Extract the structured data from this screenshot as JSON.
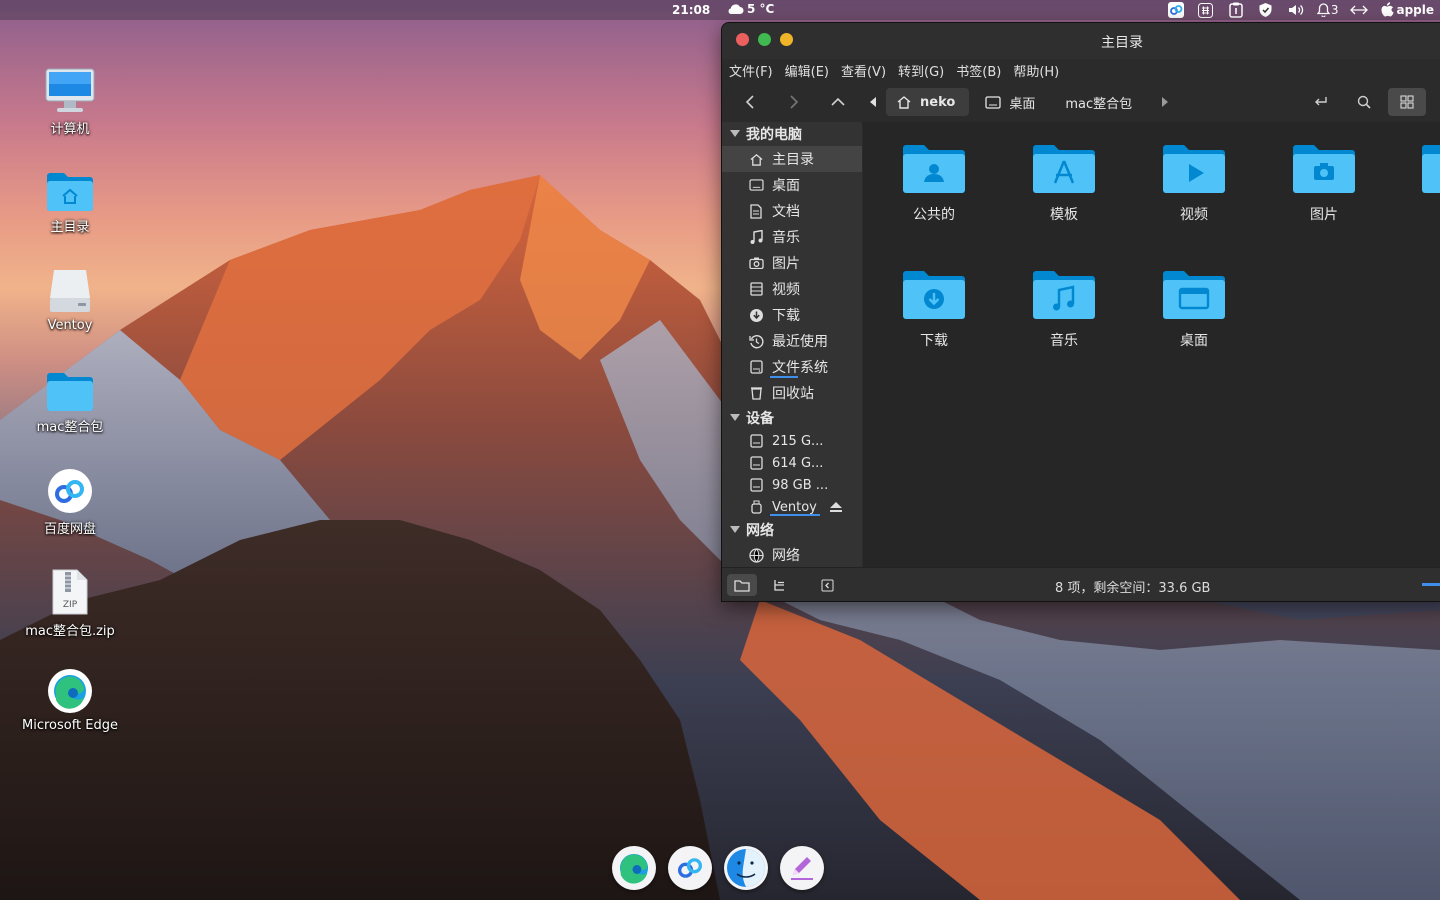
{
  "topbar": {
    "clock": "21:08",
    "weather": "5 °C",
    "notifications": "3",
    "user": "apple"
  },
  "desktop": {
    "icons": [
      {
        "label": "计算机",
        "icon": "computer-icon"
      },
      {
        "label": "主目录",
        "icon": "home-folder-icon"
      },
      {
        "label": "Ventoy",
        "icon": "drive-icon"
      },
      {
        "label": "mac整合包",
        "icon": "folder-icon"
      },
      {
        "label": "百度网盘",
        "icon": "baidu-netdisk-icon"
      },
      {
        "label": "mac整合包.zip",
        "icon": "zip-file-icon",
        "badge": "ZIP"
      },
      {
        "label": "Microsoft Edge",
        "icon": "edge-icon"
      }
    ]
  },
  "dock": [
    "edge-icon",
    "baidu-netdisk-icon",
    "finder-icon",
    "text-editor-icon"
  ],
  "window": {
    "title": "主目录",
    "menu": [
      "文件(F)",
      "编辑(E)",
      "查看(V)",
      "转到(G)",
      "书签(B)",
      "帮助(H)"
    ],
    "breadcrumbs": [
      "neko",
      "桌面",
      "mac整合包"
    ],
    "sidebar": {
      "sections": [
        {
          "title": "我的电脑",
          "items": [
            "主目录",
            "桌面",
            "文档",
            "音乐",
            "图片",
            "视频",
            "下载",
            "最近使用",
            "文件系统",
            "回收站"
          ]
        },
        {
          "title": "设备",
          "items": [
            "215 G...",
            "614 G...",
            "98 GB ...",
            "Ventoy"
          ]
        },
        {
          "title": "网络",
          "items": [
            "网络"
          ]
        }
      ]
    },
    "folders": [
      {
        "label": "公共的",
        "icon": "public-folder-icon"
      },
      {
        "label": "模板",
        "icon": "templates-folder-icon"
      },
      {
        "label": "视频",
        "icon": "videos-folder-icon"
      },
      {
        "label": "图片",
        "icon": "pictures-folder-icon"
      },
      {
        "label": "下载",
        "icon": "downloads-folder-icon"
      },
      {
        "label": "音乐",
        "icon": "music-folder-icon"
      },
      {
        "label": "桌面",
        "icon": "desktop-folder-icon"
      }
    ],
    "status": "8 项，剩余空间：33.6 GB"
  },
  "colors": {
    "folder": "#4fc3f7",
    "folder_dark": "#0288d1",
    "close": "#ec5f5f",
    "minimize": "#3fb950",
    "maximize": "#f0b429",
    "accent": "#3f8ee9"
  }
}
